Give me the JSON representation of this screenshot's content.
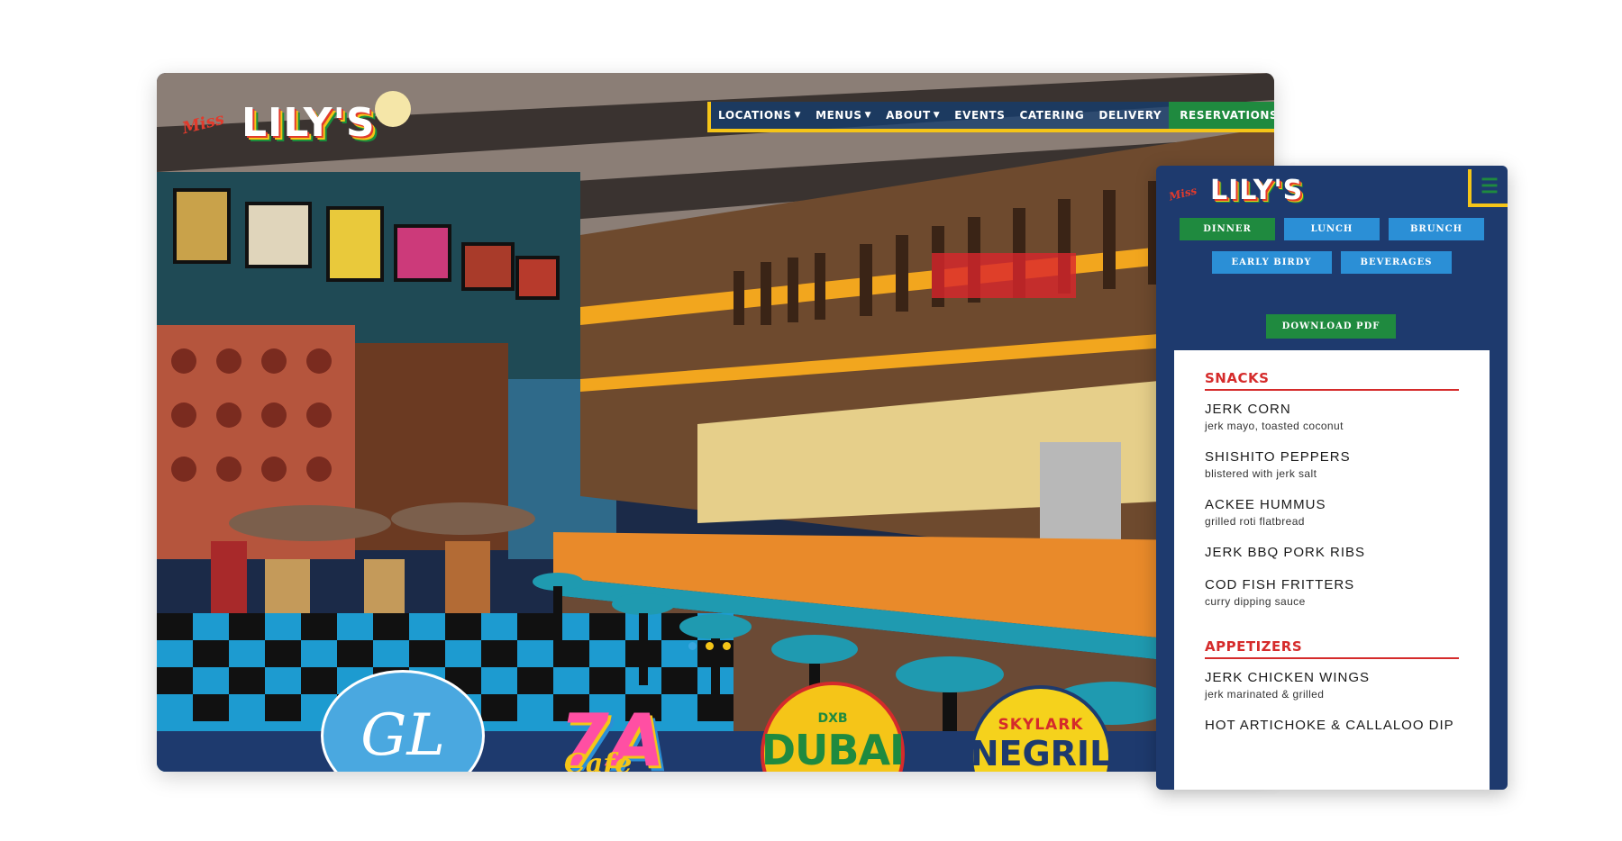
{
  "brand": {
    "miss": "Miss",
    "name": "LILY'S"
  },
  "nav": {
    "items": [
      {
        "label": "LOCATIONS",
        "dropdown": true
      },
      {
        "label": "MENUS",
        "dropdown": true
      },
      {
        "label": "ABOUT",
        "dropdown": true
      },
      {
        "label": "EVENTS",
        "dropdown": false
      },
      {
        "label": "CATERING",
        "dropdown": false
      },
      {
        "label": "DELIVERY",
        "dropdown": false
      }
    ],
    "reservations": "RESERVATIONS"
  },
  "carousel": {
    "slides": 3,
    "active": 1
  },
  "location_badges": {
    "gl": "GL",
    "seven_a": "7A",
    "seven_a_sub": "Cafe",
    "dubai_top": "DXB",
    "dubai_main": "DUBAI",
    "negril_top": "SKYLARK",
    "negril_main": "NEGRIL"
  },
  "mobile": {
    "menu_tabs_row1": [
      "DINNER",
      "LUNCH",
      "BRUNCH"
    ],
    "menu_tabs_row2": [
      "EARLY BIRDY",
      "BEVERAGES"
    ],
    "active_tab": "DINNER",
    "download": "DOWNLOAD PDF",
    "sections": [
      {
        "title": "SNACKS",
        "items": [
          {
            "name": "JERK CORN",
            "desc": "jerk mayo, toasted coconut"
          },
          {
            "name": "SHISHITO PEPPERS",
            "desc": "blistered with jerk salt"
          },
          {
            "name": "ACKEE HUMMUS",
            "desc": "grilled roti flatbread"
          },
          {
            "name": "JERK BBQ PORK RIBS",
            "desc": ""
          },
          {
            "name": "COD FISH FRITTERS",
            "desc": "curry dipping sauce"
          }
        ]
      },
      {
        "title": "APPETIZERS",
        "items": [
          {
            "name": "JERK CHICKEN WINGS",
            "desc": "jerk marinated & grilled"
          },
          {
            "name": "HOT ARTICHOKE & CALLALOO DIP",
            "desc": ""
          }
        ]
      }
    ]
  },
  "colors": {
    "navy": "#1e3a6e",
    "green": "#1f8a3f",
    "yellow": "#f5c518",
    "red": "#d52b2b",
    "blue": "#2b8fd6"
  }
}
